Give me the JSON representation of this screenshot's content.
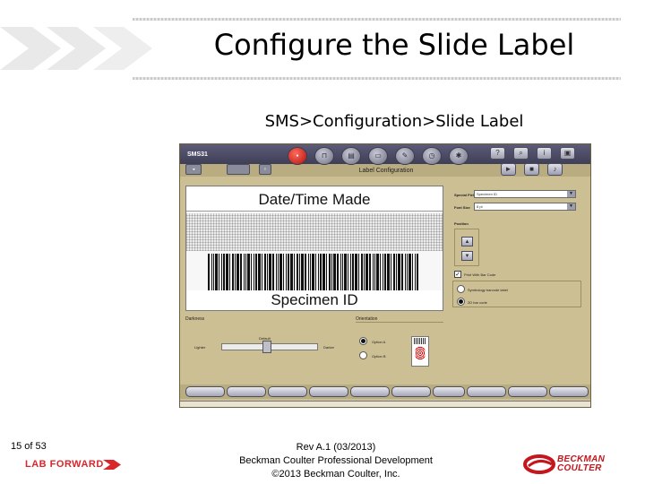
{
  "slide": {
    "title": "Configure the Slide Label",
    "path": "SMS>Configuration>Slide Label"
  },
  "app": {
    "name": "SMS31",
    "window_title": "Label Configuration",
    "label_preview": {
      "top_text": "Date/Time Made",
      "bottom_text": "Specimen ID"
    },
    "right_panel": {
      "special_field_label": "Special Field",
      "special_field_value": "Specimen ID",
      "font_size_label": "Font Size",
      "font_size_value": "8 pt",
      "position_label": "Position",
      "print_barcode_label": "Print With Bar Code",
      "option_symbology": "Symbology barcode label",
      "option_2d": "2D bar code"
    },
    "darkness": {
      "section_label": "Darkness",
      "default_label": "Default",
      "lighter_label": "Lighter",
      "darker_label": "Darker"
    },
    "orientation": {
      "section_label": "Orientation",
      "option_a": "Option A",
      "option_b": "Option B"
    },
    "colors": {
      "background": "#cdbf94",
      "topbar": "#343449",
      "accent_red": "#c4161c"
    },
    "icons": [
      "back-arrow-icon",
      "home-icon",
      "settings-icon",
      "record-icon",
      "tube-icon",
      "print-icon",
      "slide-icon",
      "wrench-icon",
      "clock-icon",
      "gear-icon",
      "help-icon",
      "search-icon",
      "play-icon",
      "stop-icon",
      "sound-icon"
    ]
  },
  "footer": {
    "page": "15 of 53",
    "brand": "LAB FORWARD",
    "rev": "Rev A.1 (03/2013)",
    "dept": "Beckman Coulter Professional Development",
    "copyright": "©2013 Beckman Coulter, Inc.",
    "logo_text_1": "BECKMAN",
    "logo_text_2": "COULTER"
  }
}
